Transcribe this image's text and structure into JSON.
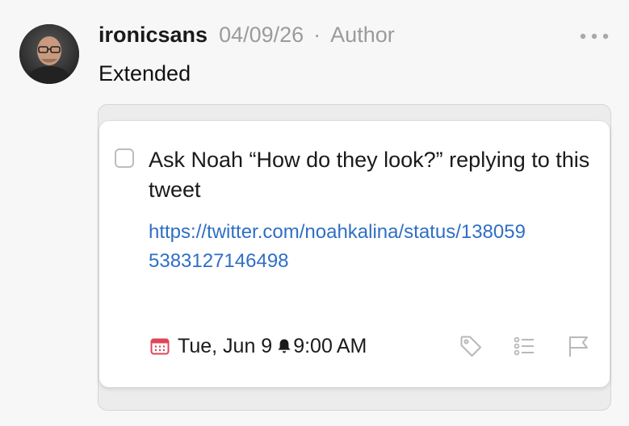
{
  "comment": {
    "username": "ironicsans",
    "date": "04/09/26",
    "separator": "·",
    "role": "Author",
    "text": "Extended",
    "more_icon": "more-horizontal-icon"
  },
  "task": {
    "title": "Ask Noah “How do they look?” replying to this tweet",
    "link": "https://twitter.com/noahkalina/status/1380595383127146498",
    "due_date": "Tue, Jun 9",
    "due_time": "9:00 AM",
    "icons": {
      "date": "calendar-icon",
      "reminder": "bell-icon",
      "tags": "tag-icon",
      "checklist": "checklist-icon",
      "flag": "flag-icon"
    }
  },
  "colors": {
    "link": "#2f6fc4",
    "calendar_accent": "#e0445a",
    "muted": "#9b9b9b",
    "icon_gray": "#b8b8b8"
  }
}
